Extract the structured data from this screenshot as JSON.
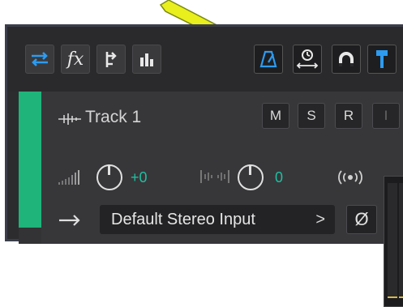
{
  "toolbar": {
    "fx_label": "fx"
  },
  "track": {
    "name": "Track 1",
    "mute_label": "M",
    "solo_label": "S",
    "record_label": "R",
    "input_monitor_label": "I",
    "volume_value": "+0",
    "pan_value": "0",
    "input_label": "Default Stereo Input",
    "input_chevron": ">",
    "phase_symbol": "Ø"
  },
  "annotation": {
    "arrow_color": "#e8ef1c"
  },
  "colors": {
    "accent_blue": "#2d9bf0",
    "track_green": "#1fb47a",
    "value_teal": "#1fbfa0"
  },
  "icons": [
    "swap-arrows-icon",
    "fx-icon",
    "send-icon",
    "eq-bars-icon",
    "metronome-icon",
    "time-stretch-icon",
    "magnet-icon",
    "pin-icon",
    "waveform-icon",
    "volume-icon",
    "pan-icon",
    "broadcast-icon",
    "input-arrow-icon"
  ]
}
